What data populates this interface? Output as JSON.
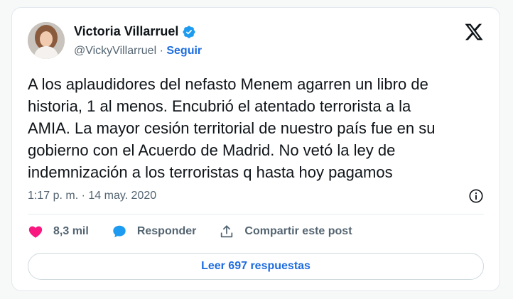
{
  "tweet": {
    "author_name": "Victoria Villarruel",
    "handle": "@VickyVillarruel",
    "separator": " · ",
    "follow_label": "Seguir",
    "text": "A los aplaudidores del nefasto Menem agarren un libro de\nhistoria, 1 al menos. Encubrió el atentado terrorista a la\nAMIA. La mayor cesión territorial de nuestro país fue en su\ngobierno con el Acuerdo de Madrid. No vetó la ley de\nindemnización a los terroristas q hasta hoy pagamos",
    "timestamp": "1:17 p. m. · 14 may. 2020",
    "likes": "8,3 mil",
    "reply_label": "Responder",
    "share_label": "Compartir este post",
    "read_replies_label": "Leer 697 respuestas"
  },
  "icons": {
    "verified": "verified-badge-icon",
    "platform": "x-logo-icon",
    "info": "info-icon",
    "like": "heart-icon",
    "reply": "speech-bubble-icon",
    "share": "share-icon"
  },
  "colors": {
    "accent": "#1d6ce0",
    "verified": "#1d9bf0",
    "like": "#f91880",
    "secondary_text": "#536471"
  }
}
